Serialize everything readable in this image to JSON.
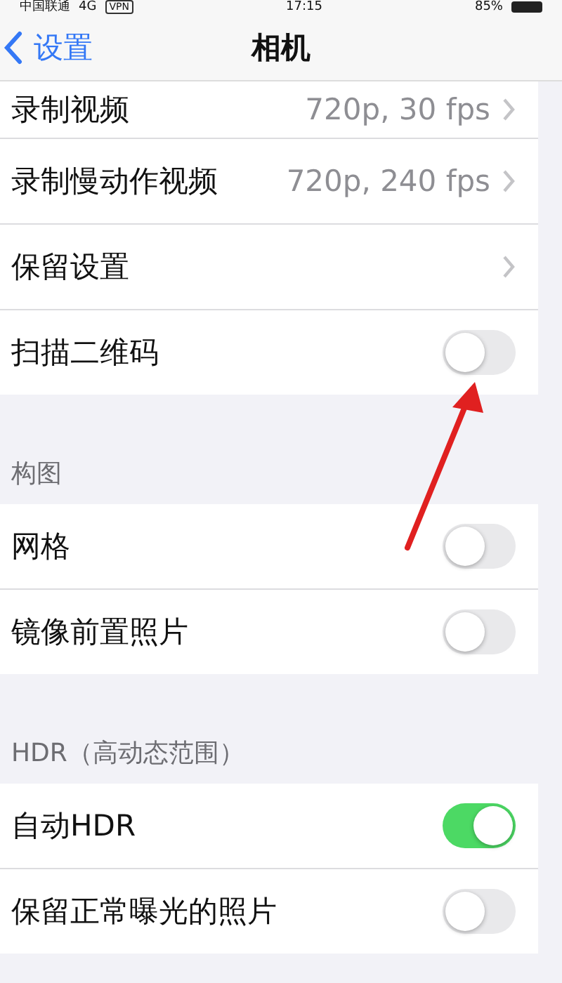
{
  "status_bar": {
    "carrier": "中国联通",
    "network": "4G",
    "vpn": "VPN",
    "time": "17:15",
    "battery": "85%"
  },
  "nav": {
    "back": "设置",
    "title": "相机"
  },
  "sections": [
    {
      "items": [
        {
          "kind": "link",
          "label": "录制视频",
          "value": "720p, 30 fps"
        },
        {
          "kind": "link",
          "label": "录制慢动作视频",
          "value": "720p, 240 fps"
        },
        {
          "kind": "link",
          "label": "保留设置"
        },
        {
          "kind": "toggle",
          "label": "扫描二维码",
          "on": false
        }
      ]
    },
    {
      "header": "构图",
      "items": [
        {
          "kind": "toggle",
          "label": "网格",
          "on": false
        },
        {
          "kind": "toggle",
          "label": "镜像前置照片",
          "on": false
        }
      ]
    },
    {
      "header": "HDR（高动态范围）",
      "items": [
        {
          "kind": "toggle",
          "label": "自动HDR",
          "on": true
        },
        {
          "kind": "toggle",
          "label": "保留正常曝光的照片",
          "on": false
        }
      ]
    }
  ]
}
